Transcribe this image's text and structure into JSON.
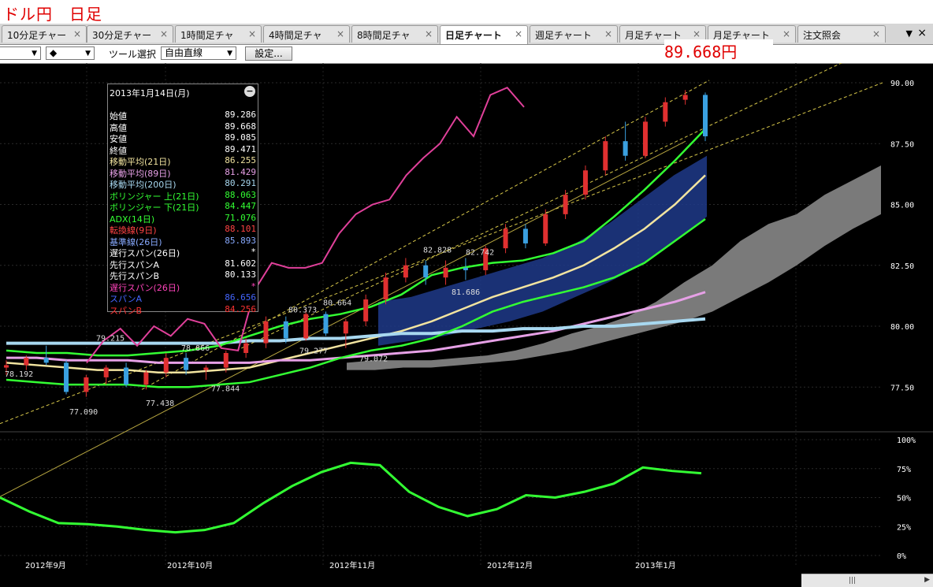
{
  "app_title": "ドル円　日足",
  "tabs": [
    {
      "label": "10分足チャー",
      "close": "×"
    },
    {
      "label": "30分足チャー",
      "close": "×"
    },
    {
      "label": "1時間足チャ",
      "close": "×"
    },
    {
      "label": "4時間足チャ",
      "close": "×"
    },
    {
      "label": "8時間足チャ",
      "close": "×"
    },
    {
      "label": "日足チャート",
      "close": "×",
      "active": true
    },
    {
      "label": "週足チャート",
      "close": "×"
    },
    {
      "label": "月足チャート",
      "close": "×"
    },
    {
      "label": "月足チャート",
      "close": "×"
    },
    {
      "label": "注文照会",
      "close": "×"
    }
  ],
  "tab_menu_glyph": "▼",
  "window_close": "×",
  "toolbar": {
    "candle_glyph": "◆",
    "tool_label": "ツール選択",
    "tool_value": "自由直線",
    "settings_button": "設定..."
  },
  "current_price": "89.668円",
  "info_panel": {
    "date": "2013年1月14日(月)",
    "minimize": "−",
    "rows": [
      {
        "label": "始値",
        "value": "89.286",
        "color": "#ffffff"
      },
      {
        "label": "高値",
        "value": "89.668",
        "color": "#ffffff"
      },
      {
        "label": "安値",
        "value": "89.085",
        "color": "#ffffff"
      },
      {
        "label": "終値",
        "value": "89.471",
        "color": "#ffffff"
      },
      {
        "label": "移動平均(21日)",
        "value": "86.255",
        "color": "#f2e4a0"
      },
      {
        "label": "移動平均(89日)",
        "value": "81.429",
        "color": "#e6a0e6"
      },
      {
        "label": "移動平均(200日)",
        "value": "80.291",
        "color": "#a8d8f0"
      },
      {
        "label": "ボリンジャー 上(21日)",
        "value": "88.063",
        "color": "#33ff33"
      },
      {
        "label": "ボリンジャー 下(21日)",
        "value": "84.447",
        "color": "#33ff33"
      },
      {
        "label": "ADX(14日)",
        "value": "71.076",
        "color": "#33ff33"
      },
      {
        "label": "転換線(9日)",
        "value": "88.101",
        "color": "#ff4444"
      },
      {
        "label": "基準線(26日)",
        "value": "85.893",
        "color": "#88aaff"
      },
      {
        "label": "遅行スパン(26日)",
        "value": "*",
        "color": "#ffffff"
      },
      {
        "label": "先行スパンA",
        "value": "81.602",
        "color": "#ffffff"
      },
      {
        "label": "先行スパンB",
        "value": "80.133",
        "color": "#ffffff"
      },
      {
        "label": "遅行スパン(26日)",
        "value": "*",
        "color": "#ff44bb"
      },
      {
        "label": "スパンA",
        "value": "86.656",
        "color": "#4466ff"
      },
      {
        "label": "スパンB",
        "value": "84.256",
        "color": "#ff3333"
      }
    ]
  },
  "chart_data": {
    "type": "line",
    "price_axis_ticks": [
      "90.00",
      "87.50",
      "85.00",
      "82.50",
      "80.00",
      "77.50"
    ],
    "price_range": [
      76.5,
      90.5
    ],
    "adx_axis_ticks": [
      "100%",
      "75%",
      "50%",
      "25%",
      "0%"
    ],
    "x_labels": [
      "2012年9月",
      "2012年10月",
      "2012年11月",
      "2012年12月",
      "2013年1月"
    ],
    "annotations": [
      {
        "text": "78.192",
        "price": 78.192
      },
      {
        "text": "79.215",
        "price": 79.215
      },
      {
        "text": "77.090",
        "price": 77.09
      },
      {
        "text": "77.438",
        "price": 77.438
      },
      {
        "text": "78.866",
        "price": 78.866
      },
      {
        "text": "77.844",
        "price": 77.844
      },
      {
        "text": "80.373",
        "price": 80.373
      },
      {
        "text": "79.277",
        "price": 79.277
      },
      {
        "text": "80.664",
        "price": 80.664
      },
      {
        "text": "79.072",
        "price": 79.072
      },
      {
        "text": "82.828",
        "price": 82.828
      },
      {
        "text": "82.742",
        "price": 82.742
      },
      {
        "text": "81.686",
        "price": 81.686
      }
    ],
    "series": [
      {
        "name": "移動平均(21日)",
        "color": "#f2e4a0",
        "values": [
          78.5,
          78.4,
          78.3,
          78.2,
          78.2,
          78.1,
          78.1,
          78.2,
          78.3,
          78.6,
          78.9,
          79.2,
          79.5,
          79.8,
          80.2,
          80.7,
          81.2,
          81.6,
          82.0,
          82.5,
          83.2,
          84.0,
          85.0,
          86.2
        ]
      },
      {
        "name": "移動平均(89日)",
        "color": "#e6a0e6",
        "values": [
          78.7,
          78.7,
          78.6,
          78.6,
          78.6,
          78.5,
          78.5,
          78.5,
          78.5,
          78.6,
          78.6,
          78.7,
          78.8,
          78.9,
          79.0,
          79.2,
          79.4,
          79.6,
          79.8,
          80.1,
          80.4,
          80.7,
          81.0,
          81.4
        ]
      },
      {
        "name": "移動平均(200日)",
        "color": "#a8d8f0",
        "values": [
          79.3,
          79.3,
          79.3,
          79.3,
          79.3,
          79.3,
          79.3,
          79.3,
          79.4,
          79.4,
          79.5,
          79.5,
          79.6,
          79.7,
          79.7,
          79.8,
          79.8,
          79.9,
          79.9,
          80.0,
          80.0,
          80.1,
          80.2,
          80.3
        ]
      },
      {
        "name": "ボリンジャー 上(21日)",
        "color": "#33ff33",
        "values": [
          79.0,
          78.9,
          78.9,
          78.8,
          78.8,
          78.9,
          79.0,
          79.2,
          79.6,
          80.0,
          80.3,
          80.5,
          80.8,
          81.3,
          82.1,
          82.4,
          82.6,
          82.7,
          83.0,
          83.5,
          84.5,
          85.6,
          86.8,
          88.1
        ]
      },
      {
        "name": "ボリンジャー 下(21日)",
        "color": "#33ff33",
        "values": [
          77.8,
          77.7,
          77.6,
          77.6,
          77.6,
          77.5,
          77.5,
          77.6,
          77.7,
          78.0,
          78.3,
          78.7,
          79.0,
          79.2,
          79.5,
          80.0,
          80.6,
          81.0,
          81.3,
          81.6,
          82.0,
          82.6,
          83.5,
          84.4
        ]
      },
      {
        "name": "ADX(14日)",
        "color": "#33ff33",
        "values": [
          50,
          38,
          28,
          27,
          25,
          22,
          20,
          22,
          28,
          45,
          60,
          72,
          80,
          78,
          55,
          42,
          34,
          40,
          52,
          50,
          55,
          62,
          76,
          73,
          71
        ]
      }
    ],
    "candles": [
      [
        78.3,
        78.6,
        78.0,
        78.4
      ],
      [
        78.4,
        78.8,
        78.2,
        78.7
      ],
      [
        78.7,
        79.2,
        78.4,
        78.5
      ],
      [
        78.5,
        78.6,
        77.2,
        77.3
      ],
      [
        77.3,
        78.0,
        77.1,
        77.9
      ],
      [
        77.9,
        78.4,
        77.6,
        78.3
      ],
      [
        78.3,
        78.5,
        77.5,
        77.6
      ],
      [
        77.6,
        78.2,
        77.4,
        78.1
      ],
      [
        78.1,
        78.9,
        77.9,
        78.7
      ],
      [
        78.7,
        78.9,
        78.0,
        78.2
      ],
      [
        78.2,
        78.4,
        77.8,
        78.3
      ],
      [
        78.3,
        79.0,
        78.1,
        78.9
      ],
      [
        78.9,
        79.5,
        78.7,
        79.3
      ],
      [
        79.3,
        80.4,
        79.1,
        80.2
      ],
      [
        80.2,
        80.4,
        79.3,
        79.5
      ],
      [
        79.5,
        80.7,
        79.4,
        80.5
      ],
      [
        80.5,
        80.6,
        79.6,
        79.7
      ],
      [
        79.7,
        80.3,
        79.1,
        80.2
      ],
      [
        80.2,
        81.3,
        80.0,
        81.1
      ],
      [
        81.1,
        82.2,
        80.9,
        82.0
      ],
      [
        82.0,
        82.8,
        81.8,
        82.5
      ],
      [
        82.5,
        82.7,
        81.7,
        82.0
      ],
      [
        82.0,
        82.7,
        81.7,
        82.4
      ],
      [
        82.4,
        82.8,
        81.9,
        82.3
      ],
      [
        82.3,
        83.3,
        82.1,
        83.2
      ],
      [
        83.2,
        84.2,
        83.0,
        84.0
      ],
      [
        84.0,
        84.2,
        83.2,
        83.4
      ],
      [
        83.4,
        84.8,
        83.3,
        84.6
      ],
      [
        84.6,
        85.6,
        84.4,
        85.4
      ],
      [
        85.4,
        86.6,
        85.2,
        86.4
      ],
      [
        86.4,
        87.8,
        86.2,
        87.6
      ],
      [
        87.6,
        88.4,
        86.8,
        87.0
      ],
      [
        87.0,
        88.6,
        86.9,
        88.4
      ],
      [
        88.4,
        89.4,
        88.2,
        89.2
      ],
      [
        89.3,
        89.7,
        89.1,
        89.5
      ],
      [
        89.5,
        89.6,
        87.6,
        87.8
      ]
    ]
  }
}
